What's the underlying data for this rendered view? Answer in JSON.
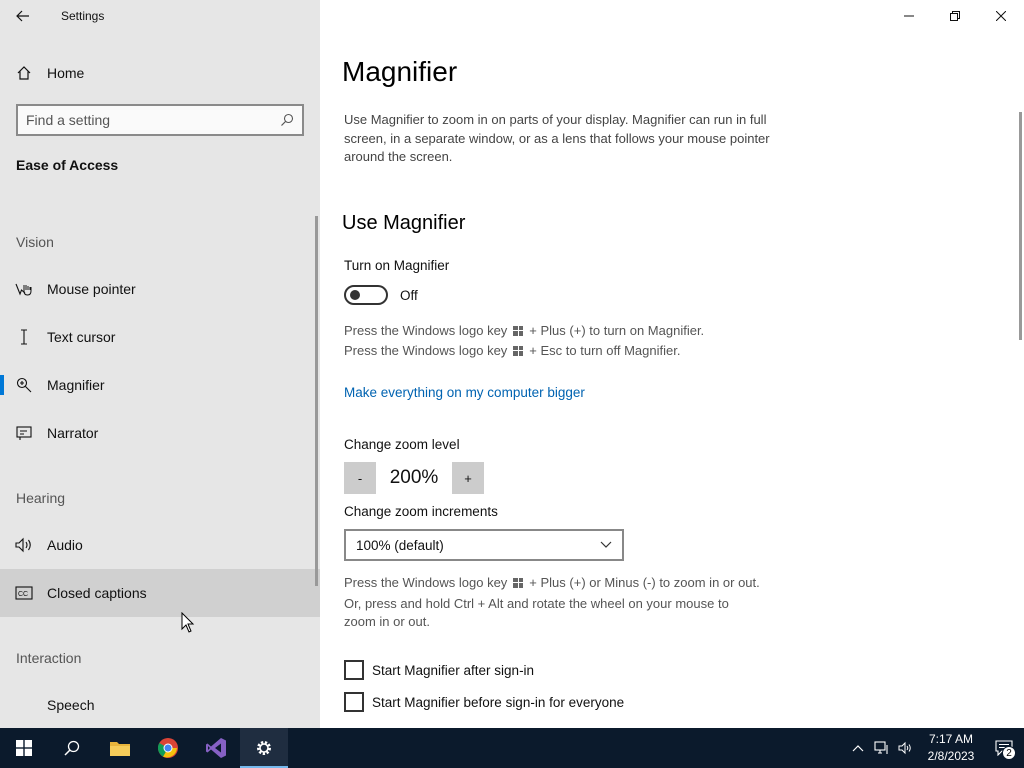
{
  "window": {
    "title": "Settings"
  },
  "sidebar": {
    "home_label": "Home",
    "search_placeholder": "Find a setting",
    "section_title": "Ease of Access",
    "groups": [
      {
        "header": "Vision",
        "items": [
          {
            "label": "Mouse pointer",
            "icon": "mouse-pointer-icon"
          },
          {
            "label": "Text cursor",
            "icon": "text-cursor-icon"
          },
          {
            "label": "Magnifier",
            "icon": "magnifier-icon",
            "selected": true
          },
          {
            "label": "Narrator",
            "icon": "narrator-icon"
          }
        ]
      },
      {
        "header": "Hearing",
        "items": [
          {
            "label": "Audio",
            "icon": "audio-icon"
          },
          {
            "label": "Closed captions",
            "icon": "closed-captions-icon",
            "hovered": true
          }
        ]
      },
      {
        "header": "Interaction",
        "items": [
          {
            "label": "Speech",
            "icon": "speech-icon"
          }
        ]
      }
    ]
  },
  "main": {
    "title": "Magnifier",
    "description": "Use Magnifier to zoom in on parts of your display. Magnifier can run in full screen, in a separate window, or as a lens that follows your mouse pointer around the screen.",
    "use_heading": "Use Magnifier",
    "turn_on_label": "Turn on Magnifier",
    "toggle_state": "Off",
    "hint_on_pre": "Press the Windows logo key",
    "hint_on_post": "+ Plus (+) to turn on Magnifier.",
    "hint_off_pre": "Press the Windows logo key",
    "hint_off_post": "+ Esc to turn off Magnifier.",
    "link": "Make everything on my computer bigger",
    "zoom_level_label": "Change zoom level",
    "zoom_minus": "-",
    "zoom_value": "200%",
    "zoom_plus": "+",
    "zoom_increment_label": "Change zoom increments",
    "zoom_increment_value": "100% (default)",
    "hint_zoom_pre": "Press the Windows logo key",
    "hint_zoom_post": "+ Plus (+) or Minus (-) to zoom in or out.",
    "hint_zoom_2": "Or, press and hold Ctrl + Alt and rotate the wheel on your mouse to",
    "hint_zoom_3": "zoom in or out.",
    "checkbox_after": "Start Magnifier after sign-in",
    "checkbox_before": "Start Magnifier before sign-in for everyone"
  },
  "taskbar": {
    "time": "7:17 AM",
    "date": "2/8/2023",
    "notification_count": "2",
    "apps": [
      "start-icon",
      "search-icon",
      "file-explorer-icon",
      "chrome-icon",
      "visual-studio-icon",
      "settings-icon"
    ]
  },
  "colors": {
    "accent": "#0078d7",
    "link": "#0063b1",
    "taskbar": "#0b1a2c",
    "sidebar": "#e6e6e6"
  }
}
